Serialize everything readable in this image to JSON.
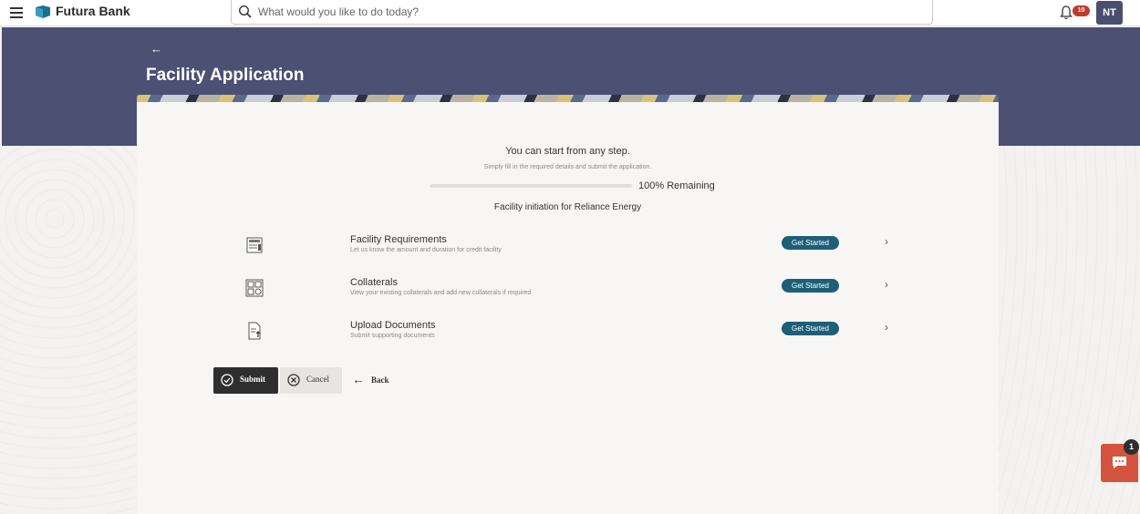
{
  "header": {
    "brand": "Futura Bank",
    "search_placeholder": "What would you like to do today?",
    "notification_count": "10",
    "avatar_initials": "NT"
  },
  "page": {
    "title": "Facility Application",
    "back_icon": "arrow-left-icon"
  },
  "intro": {
    "title": "You can start from any step.",
    "subtitle": "Simply fill in the required details and submit the application.",
    "progress_fraction": 0,
    "progress_label": "100% Remaining",
    "initiation_text": "Facility initiation for Reliance Energy"
  },
  "steps": [
    {
      "title": "Facility Requirements",
      "description": "Let us know the amount and duration for credit facility",
      "button": "Get Started",
      "icon": "facility-document-icon"
    },
    {
      "title": "Collaterals",
      "description": "View your existing collaterals and add new collaterals if required",
      "button": "Get Started",
      "icon": "collateral-icon"
    },
    {
      "title": "Upload Documents",
      "description": "Submit supporting documents",
      "button": "Get Started",
      "icon": "upload-document-icon"
    }
  ],
  "actions": {
    "submit": "Submit",
    "cancel": "Cancel",
    "back": "Back"
  },
  "chat": {
    "badge": "1",
    "icon": "chat-icon"
  },
  "colors": {
    "hero": "#4c5072",
    "accent": "#1d5f77",
    "chat": "#d4553f",
    "badge": "#c1392b"
  }
}
